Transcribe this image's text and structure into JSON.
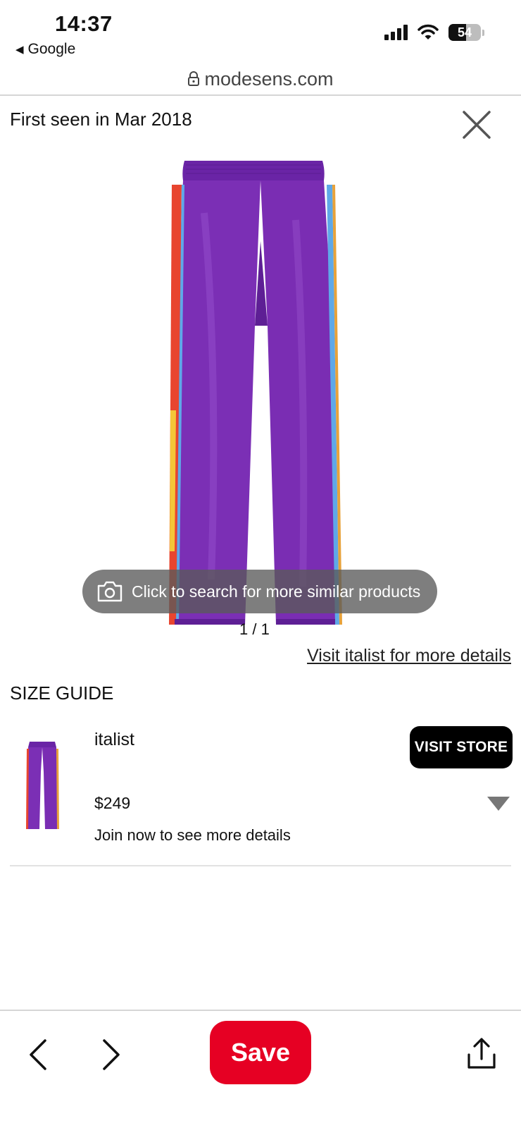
{
  "status_bar": {
    "time": "14:37",
    "back_app": "Google",
    "battery_level": "54",
    "signal_icon": "signal-bars-icon",
    "wifi_icon": "wifi-icon"
  },
  "url_bar": {
    "domain": "modesens.com",
    "icon": "lock-icon"
  },
  "product": {
    "first_seen": "First seen in Mar 2018",
    "image_search_prompt": "Click to search for more similar products",
    "image_counter": "1 / 1",
    "visit_link": "Visit italist for more details",
    "primary_color": "#7b2fb5"
  },
  "size_guide": {
    "heading": "SIZE GUIDE"
  },
  "offers": [
    {
      "store": "italist",
      "price": "$249",
      "note": "Join now to see more details",
      "button_label": "VISIT STORE"
    }
  ],
  "toolbar": {
    "prev_icon": "chevron-left-icon",
    "next_icon": "chevron-right-icon",
    "save_label": "Save",
    "save_color": "#e60023",
    "share_icon": "share-icon"
  }
}
